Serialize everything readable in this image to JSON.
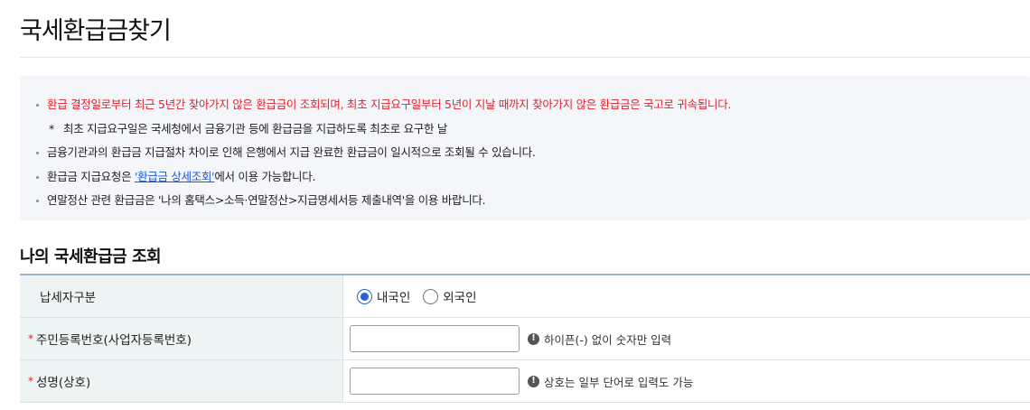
{
  "page": {
    "title": "국세환급금찾기"
  },
  "notice": {
    "items": [
      {
        "type": "red",
        "text": "환급 결정일로부터 최근 5년간 찾아가지 않은 환급금이 조회되며, 최초 지급요구일부터 5년이 지날 때까지 찾아가지 않은 환급금은 국고로 귀속됩니다."
      },
      {
        "type": "sub",
        "star": "*",
        "text": "최초 지급요구일은 국세청에서 금융기관 등에 환급금을 지급하도록 최초로 요구한 날"
      },
      {
        "type": "normal",
        "text": "금융기관과의 환급금 지급절차 차이로 인해 은행에서 지급 완료한 환급금이 일시적으로 조회될 수 있습니다."
      },
      {
        "type": "link",
        "before": "환급금 지급요청은 ",
        "link": "'환급금 상세조회'",
        "after": "에서 이용 가능합니다."
      },
      {
        "type": "normal",
        "text": "연말정산 관련 환급금은 '나의 홈택스>소득·연말정산>지급명세서등 제출내역'을 이용 바랍니다."
      }
    ]
  },
  "section": {
    "title": "나의 국세환급금 조회"
  },
  "form": {
    "taxpayer_type": {
      "label": "납세자구분",
      "options": [
        {
          "label": "내국인",
          "checked": true
        },
        {
          "label": "외국인",
          "checked": false
        }
      ]
    },
    "resident_number": {
      "required_mark": "*",
      "label": "주민등록번호(사업자등록번호)",
      "value": "",
      "hint_icon": "!",
      "hint": "하이픈(-) 없이 숫자만 입력"
    },
    "name": {
      "required_mark": "*",
      "label": "성명(상호)",
      "value": "",
      "hint_icon": "!",
      "hint": "상호는 일부 단어로 입력도 가능"
    }
  },
  "colors": {
    "required": "#e0222b",
    "link": "#1a56db",
    "radio_checked": "#2b5fd9",
    "label_bg": "#eef4f4",
    "notice_bg": "#f4f6fa"
  }
}
